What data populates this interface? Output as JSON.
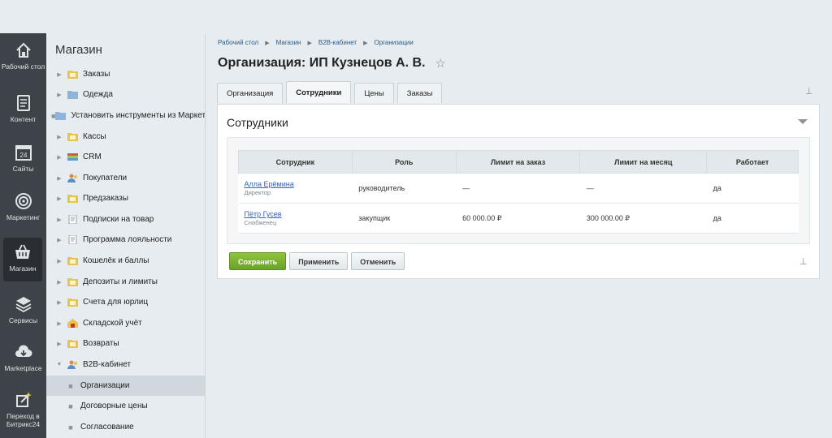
{
  "rail": {
    "items": [
      {
        "label": "Рабочий стол",
        "icon": "home-icon"
      },
      {
        "label": "Контент",
        "icon": "document-icon"
      },
      {
        "label": "Сайты",
        "icon": "calendar-icon"
      },
      {
        "label": "Маркетинг",
        "icon": "target-icon"
      },
      {
        "label": "Магазин",
        "icon": "basket-icon"
      },
      {
        "label": "Сервисы",
        "icon": "layers-icon"
      },
      {
        "label": "Marketplace",
        "icon": "cloud-download-icon"
      },
      {
        "label": "Переход в Битрикс24",
        "icon": "magic-wand-icon"
      }
    ]
  },
  "tree": {
    "title": "Магазин",
    "items": [
      {
        "label": "Заказы"
      },
      {
        "label": "Одежда"
      },
      {
        "label": "Установить инструменты из Маркетплейс"
      },
      {
        "label": "Кассы"
      },
      {
        "label": "CRM"
      },
      {
        "label": "Покупатели"
      },
      {
        "label": "Предзаказы"
      },
      {
        "label": "Подписки на товар"
      },
      {
        "label": "Программа лояльности"
      },
      {
        "label": "Кошелёк и баллы"
      },
      {
        "label": "Депозиты и лимиты"
      },
      {
        "label": "Счета для юрлиц"
      },
      {
        "label": "Складской учёт"
      },
      {
        "label": "Возвраты"
      },
      {
        "label": "B2B-кабинет"
      },
      {
        "label": "Организации"
      },
      {
        "label": "Договорные цены"
      },
      {
        "label": "Согласование"
      }
    ]
  },
  "breadcrumb": [
    "Рабочий стол",
    "Магазин",
    "B2B-кабинет",
    "Организации"
  ],
  "page_title": "Организация: ИП Кузнецов А. В.",
  "tabs": [
    "Организация",
    "Сотрудники",
    "Цены",
    "Заказы"
  ],
  "active_tab": "Сотрудники",
  "panel": {
    "title": "Сотрудники",
    "columns": [
      "Сотрудник",
      "Роль",
      "Лимит на заказ",
      "Лимит на месяц",
      "Работает"
    ],
    "rows": [
      {
        "name": "Алла Ерёмина",
        "position": "Директор",
        "role": "руководитель",
        "order_limit": "—",
        "month_limit": "—",
        "works": "да"
      },
      {
        "name": "Пётр Гусев",
        "position": "Снабженец",
        "role": "закупщик",
        "order_limit": "60 000.00 ₽",
        "month_limit": "300 000.00 ₽",
        "works": "да"
      }
    ]
  },
  "buttons": {
    "save": "Сохранить",
    "apply": "Применить",
    "cancel": "Отменить"
  },
  "colors": {
    "accent_green": "#7ab535",
    "rail_bg": "#3d4349",
    "link": "#2a67b8"
  }
}
